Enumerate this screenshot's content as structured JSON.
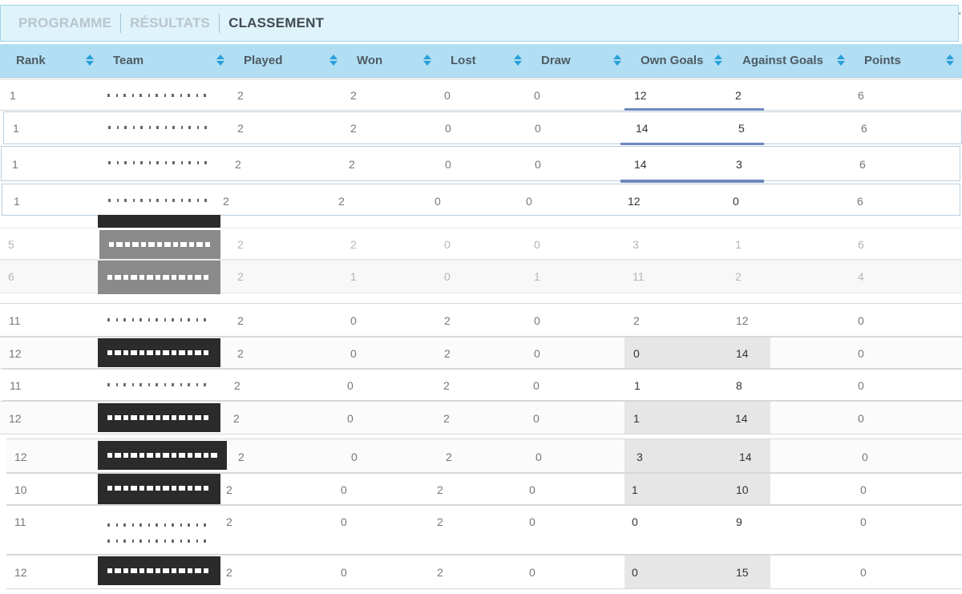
{
  "tabs": [
    {
      "label": "PROGRAMME",
      "active": false
    },
    {
      "label": "RÉSULTATS",
      "active": false
    },
    {
      "label": "CLASSEMENT",
      "active": true
    }
  ],
  "columns": [
    "Rank",
    "Team",
    "Played",
    "Won",
    "Lost",
    "Draw",
    "Own Goals",
    "Against Goals",
    "Points"
  ],
  "rows": [
    {
      "rank": "1",
      "played": "2",
      "won": "2",
      "lost": "0",
      "draw": "0",
      "own": "12",
      "against": "2",
      "points": "6"
    },
    {
      "rank": "1",
      "played": "2",
      "won": "2",
      "lost": "0",
      "draw": "0",
      "own": "14",
      "against": "5",
      "points": "6"
    },
    {
      "rank": "1",
      "played": "2",
      "won": "2",
      "lost": "0",
      "draw": "0",
      "own": "14",
      "against": "3",
      "points": "6"
    },
    {
      "rank": "1",
      "played": "2",
      "won": "2",
      "lost": "0",
      "draw": "0",
      "own": "12",
      "against": "0",
      "points": "6"
    },
    {
      "rank": "5",
      "played": "2",
      "won": "2",
      "lost": "0",
      "draw": "0",
      "own": "3",
      "against": "1",
      "points": "6"
    },
    {
      "rank": "6",
      "played": "2",
      "won": "1",
      "lost": "0",
      "draw": "1",
      "own": "11",
      "against": "2",
      "points": "4"
    },
    {
      "rank": "11",
      "played": "2",
      "won": "0",
      "lost": "2",
      "draw": "0",
      "own": "2",
      "against": "12",
      "points": "0"
    },
    {
      "rank": "12",
      "played": "2",
      "won": "0",
      "lost": "2",
      "draw": "0",
      "own": "0",
      "against": "14",
      "points": "0"
    },
    {
      "rank": "11",
      "played": "2",
      "won": "0",
      "lost": "2",
      "draw": "0",
      "own": "1",
      "against": "8",
      "points": "0"
    },
    {
      "rank": "12",
      "played": "2",
      "won": "0",
      "lost": "2",
      "draw": "0",
      "own": "1",
      "against": "14",
      "points": "0"
    },
    {
      "rank": "12",
      "played": "2",
      "won": "0",
      "lost": "2",
      "draw": "0",
      "own": "3",
      "against": "14",
      "points": "0"
    },
    {
      "rank": "10",
      "played": "2",
      "won": "0",
      "lost": "2",
      "draw": "0",
      "own": "1",
      "against": "10",
      "points": "0"
    },
    {
      "rank": "11",
      "played": "2",
      "won": "0",
      "lost": "2",
      "draw": "0",
      "own": "0",
      "against": "9",
      "points": "0"
    },
    {
      "rank": "12",
      "played": "2",
      "won": "0",
      "lost": "2",
      "draw": "0",
      "own": "0",
      "against": "15",
      "points": "0"
    }
  ],
  "colors": {
    "accent": "#2a9fd8",
    "header_bg": "#b2def4",
    "tabs_bg": "#dff3fb"
  }
}
